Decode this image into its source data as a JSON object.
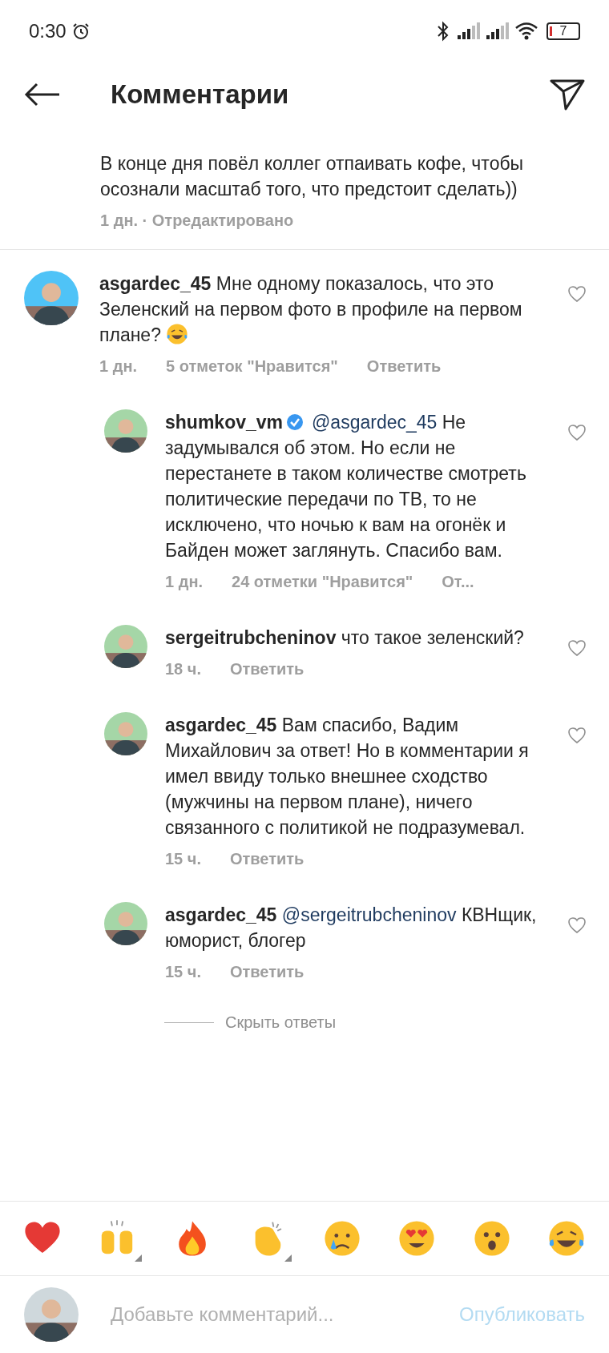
{
  "status_bar": {
    "time": "0:30",
    "battery": "7"
  },
  "header": {
    "title": "Комментарии"
  },
  "previous_comment": {
    "text": "В конце дня повёл коллег отпаивать кофе, чтобы осознали масштаб того, что предстоит сделать))",
    "meta": "1 дн. · Отредактировано"
  },
  "comments": [
    {
      "user": "asgardec_45",
      "verified": false,
      "text": "Мне одному показалось, что это Зеленский на первом фото в профиле на первом плане?",
      "has_emoji": true,
      "time": "1 дн.",
      "likes": "5 отметок \"Нравится\"",
      "reply": "Ответить",
      "children": [
        {
          "user": "shumkov_vm",
          "verified": true,
          "mention": "@asgardec_45",
          "text": "Не задумывался об этом. Но если не перестанете в таком количестве смотреть политические передачи по ТВ, то не исключено, что ночью к вам на огонёк и Байден может заглянуть. Спасибо вам.",
          "has_emoji": false,
          "time": "1 дн.",
          "likes": "24 отметки \"Нравится\"",
          "reply": "От..."
        },
        {
          "user": "sergeitrubcheninov",
          "verified": false,
          "text": "что такое зеленский?",
          "has_emoji": false,
          "time": "18 ч.",
          "reply": "Ответить"
        },
        {
          "user": "asgardec_45",
          "verified": false,
          "text": "Вам спасибо, Вадим Михайлович за ответ! Но в комментарии я имел ввиду только внешнее сходство (мужчины на первом плане), ничего связанного с политикой не подразумевал.",
          "has_emoji": false,
          "time": "15 ч.",
          "reply": "Ответить"
        },
        {
          "user": "asgardec_45",
          "verified": false,
          "mention": "@sergeitrubcheninov",
          "text": "КВНщик, юморист, блогер",
          "has_emoji": false,
          "time": "15 ч.",
          "reply": "Ответить"
        }
      ],
      "hide_replies": "Скрыть ответы"
    }
  ],
  "emoji_bar": [
    {
      "kind": "heart",
      "variants": false
    },
    {
      "kind": "raised_hands",
      "variants": true
    },
    {
      "kind": "fire",
      "variants": false
    },
    {
      "kind": "clap",
      "variants": true
    },
    {
      "kind": "crying",
      "variants": false
    },
    {
      "kind": "heart_eyes",
      "variants": false
    },
    {
      "kind": "surprised",
      "variants": false
    },
    {
      "kind": "laughing",
      "variants": false
    }
  ],
  "composer": {
    "placeholder": "Добавьте комментарий...",
    "post_button": {
      "label": "Опубликовать",
      "disabled": true
    }
  }
}
